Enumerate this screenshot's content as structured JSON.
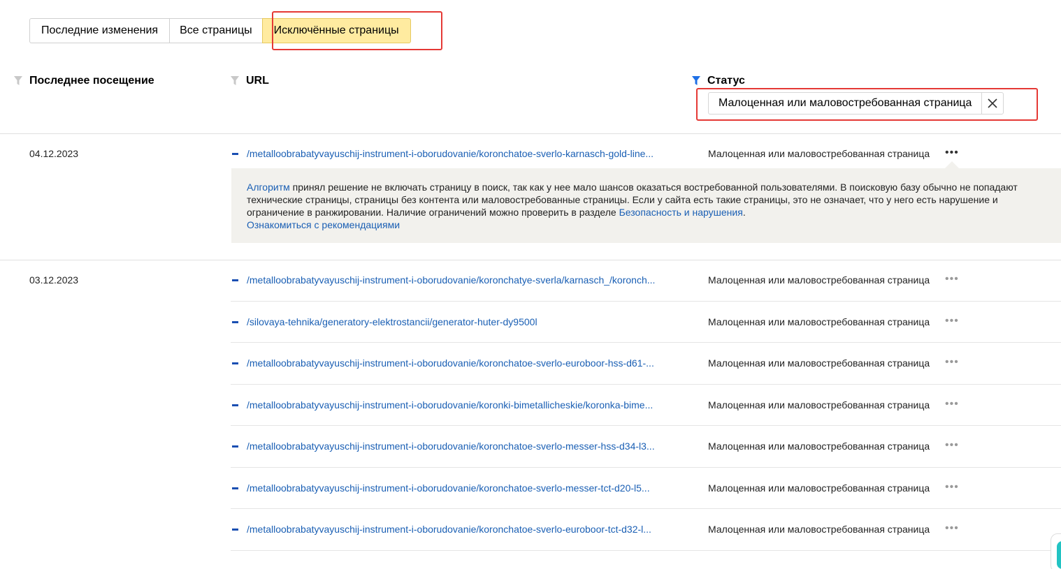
{
  "tabs": [
    {
      "label": "Последние изменения",
      "active": false
    },
    {
      "label": "Все страницы",
      "active": false
    },
    {
      "label": "Исключённые страницы",
      "active": true
    }
  ],
  "columns": {
    "date": "Последнее посещение",
    "url": "URL",
    "status": "Статус"
  },
  "status_filter": {
    "value": "Малоценная или маловостребованная страница"
  },
  "groups": [
    {
      "date": "04.12.2023",
      "rows": [
        {
          "url": "/metalloobrabatyvayuschij-instrument-i-oborudovanie/koronchatoe-sverlo-karnasch-gold-line...",
          "status": "Малоценная или маловостребованная страница"
        }
      ]
    },
    {
      "date": "03.12.2023",
      "rows": [
        {
          "url": "/metalloobrabatyvayuschij-instrument-i-oborudovanie/koronchatye-sverla/karnasch_/koronch...",
          "status": "Малоценная или маловостребованная страница"
        },
        {
          "url": "/silovaya-tehnika/generatory-elektrostancii/generator-huter-dy9500l",
          "status": "Малоценная или маловостребованная страница"
        },
        {
          "url": "/metalloobrabatyvayuschij-instrument-i-oborudovanie/koronchatoe-sverlo-euroboor-hss-d61-...",
          "status": "Малоценная или маловостребованная страница"
        },
        {
          "url": "/metalloobrabatyvayuschij-instrument-i-oborudovanie/koronki-bimetallicheskie/koronka-bime...",
          "status": "Малоценная или маловостребованная страница"
        },
        {
          "url": "/metalloobrabatyvayuschij-instrument-i-oborudovanie/koronchatoe-sverlo-messer-hss-d34-l3...",
          "status": "Малоценная или маловостребованная страница"
        },
        {
          "url": "/metalloobrabatyvayuschij-instrument-i-oborudovanie/koronchatoe-sverlo-messer-tct-d20-l5...",
          "status": "Малоценная или маловостребованная страница"
        },
        {
          "url": "/metalloobrabatyvayuschij-instrument-i-oborudovanie/koronchatoe-sverlo-euroboor-tct-d32-l...",
          "status": "Малоценная или маловостребованная страница"
        }
      ]
    }
  ],
  "info": {
    "link_algorithm": "Алгоритм",
    "text_1": " принял решение не включать страницу в поиск, так как у нее мало шансов оказаться востребованной пользователями. В поисковую базу обычно не попадают",
    "text_2": "технические страницы, страницы без контента или маловостребованные страницы. Если у сайта есть такие страницы, это не означает, что у него есть нарушение и",
    "text_3": "ограничение в ранжировании. Наличие ограничений можно проверить в разделе ",
    "link_security": "Безопасность и нарушения",
    "text_4": ".",
    "link_recommendations": "Ознакомиться с рекомендациями"
  },
  "icons": {
    "filter": "filter-icon",
    "filter_active": "filter-active-icon",
    "close": "close-icon",
    "more": "more-icon",
    "collapse": "minus-icon"
  },
  "colors": {
    "active_tab": "#ffeba0",
    "link": "#1a5fb4",
    "highlight": "#e53935",
    "filter_active": "#1e6fe6"
  }
}
